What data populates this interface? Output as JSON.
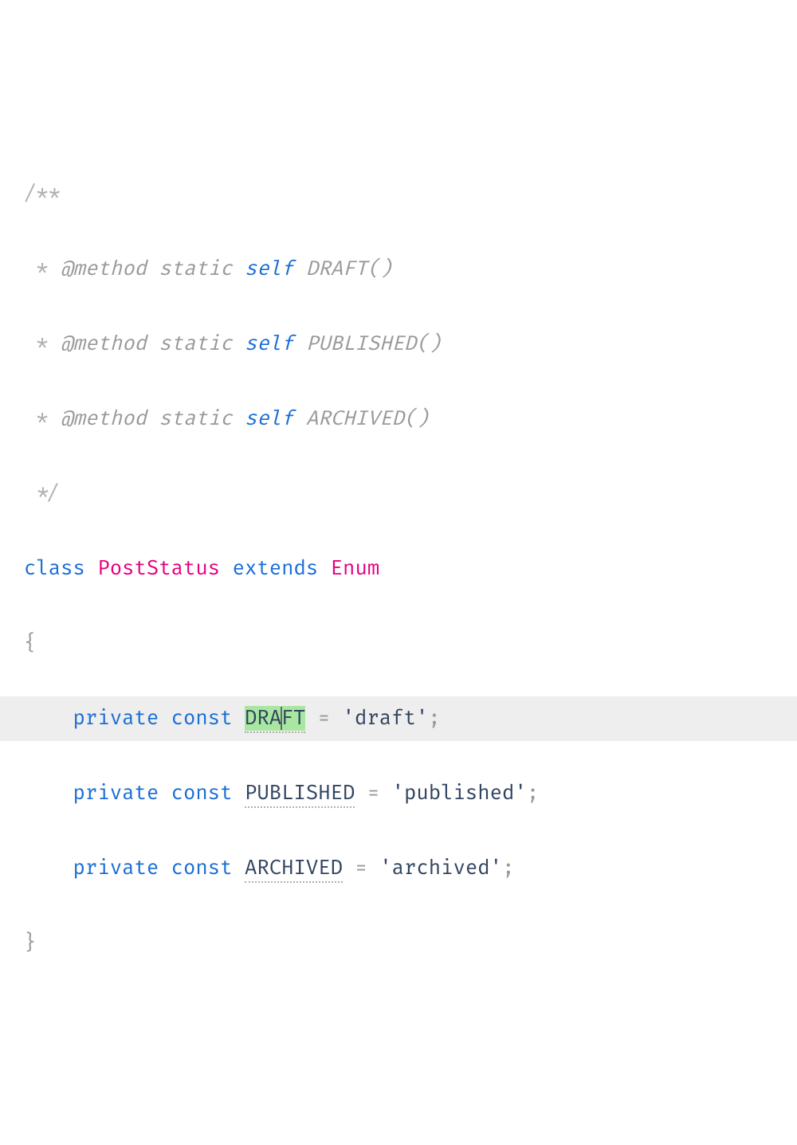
{
  "colors": {
    "comment": "#b0b0b0",
    "tag": "#999999",
    "self": "#1a6dd6",
    "keyword": "#1a6dd6",
    "class": "#e6007e",
    "string": "#30445f",
    "const": "#30445f",
    "currentLineBg": "#eeeeee",
    "selectionBg": "#a8e6a1"
  },
  "doc": {
    "open": "/**",
    "star": " * ",
    "close": " */",
    "methodTag": "@method",
    "staticKw": "static",
    "selfKw": "self",
    "methods": {
      "0": "DRAFT()",
      "1": "PUBLISHED()",
      "2": "ARCHIVED()"
    }
  },
  "cls": {
    "classKw": "class",
    "name": "PostStatus",
    "extendsKw": "extends",
    "parent": "Enum",
    "openBrace": "{",
    "closeBrace": "}"
  },
  "consts": {
    "privateKw": "private",
    "constKw": "const",
    "eq": " = ",
    "semi": ";",
    "items": {
      "0": {
        "name_a": "DRA",
        "name_b": "FT",
        "name": "DRAFT",
        "value": "'draft'"
      },
      "1": {
        "name": "PUBLISHED",
        "value": "'published'"
      },
      "2": {
        "name": "ARCHIVED",
        "value": "'archived'"
      }
    }
  },
  "editor": {
    "currentLineIndex": 7,
    "selection": {
      "line": 7,
      "token": "DRAFT",
      "range": "FT"
    },
    "caretLine": 7,
    "caretAfter": "DRA"
  }
}
